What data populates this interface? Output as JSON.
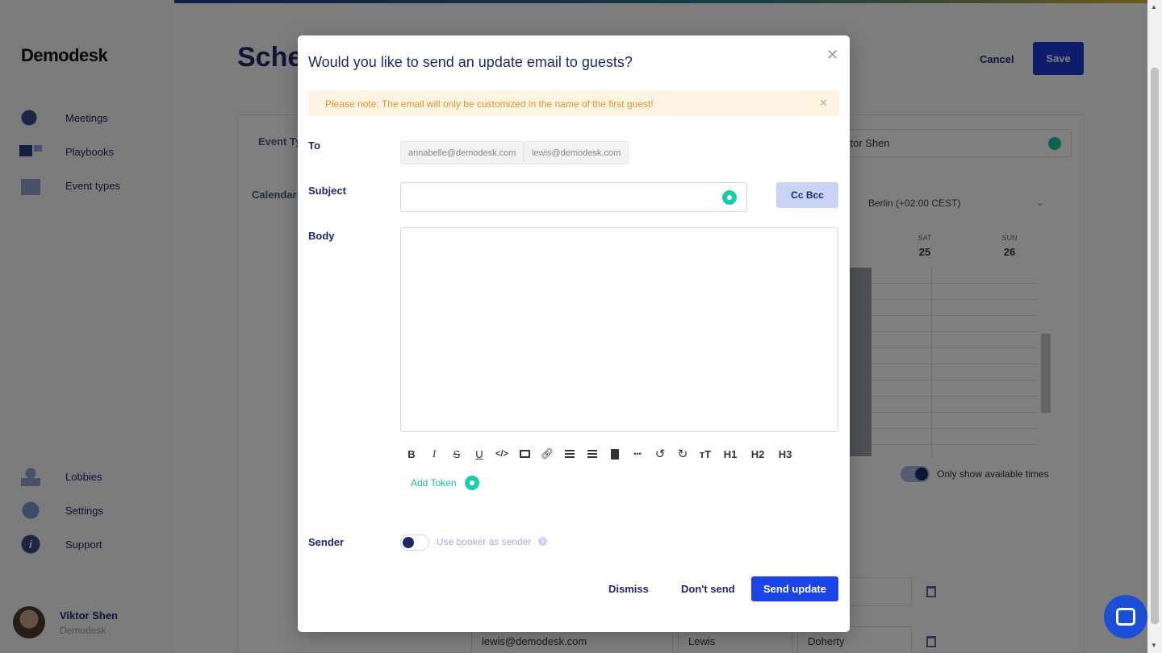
{
  "sidebar": {
    "logo": "Demodesk",
    "top_items": [
      {
        "label": "Meetings"
      },
      {
        "label": "Playbooks"
      },
      {
        "label": "Event types"
      }
    ],
    "bottom_items": [
      {
        "label": "Lobbies"
      },
      {
        "label": "Settings"
      },
      {
        "label": "Support"
      }
    ],
    "user": {
      "name": "Viktor Shen",
      "org": "Demodesk"
    }
  },
  "background": {
    "page_title": "Sche",
    "cancel_label": "Cancel",
    "save_label": "Save",
    "event_type_label": "Event Ty",
    "calendars_label": "Calendars",
    "host_select_value": "ktor Shen",
    "timezone": "Berlin (+02:00 CEST)",
    "days": [
      {
        "name": "SAT",
        "date": "25"
      },
      {
        "name": "SUN",
        "date": "26"
      }
    ],
    "available_toggle_label": "Only show available times",
    "guest_row": {
      "email": "lewis@demodesk.com",
      "first": "Lewis",
      "last": "Doherty"
    }
  },
  "modal": {
    "title": "Would you like to send an update email to guests?",
    "notice": "Please note: The email will only be customized in the name of the first guest!",
    "to_label": "To",
    "recipients": [
      "annabelle@demodesk.com",
      "lewis@demodesk.com"
    ],
    "subject_label": "Subject",
    "subject_value": "",
    "cc_bcc_label": "Cc Bcc",
    "body_label": "Body",
    "body_value": "",
    "toolbar": {
      "bold": "B",
      "italic": "I",
      "strike": "S",
      "underline": "U",
      "code": "</>",
      "undo": "↺",
      "redo": "↻",
      "more": "•••",
      "font_size": "тT",
      "h1": "H1",
      "h2": "H2",
      "h3": "H3"
    },
    "add_token_label": "Add Token",
    "sender_label": "Sender",
    "sender_toggle_label": "Use booker as sender",
    "sender_toggle_on": false,
    "dismiss_label": "Dismiss",
    "dont_send_label": "Don't send",
    "send_update_label": "Send update"
  },
  "colors": {
    "primary": "#1a44e6",
    "navy": "#1c2a6b",
    "token_green": "#1fcbb0",
    "notice_bg": "#fdf3e3",
    "notice_text": "#e0962a"
  }
}
